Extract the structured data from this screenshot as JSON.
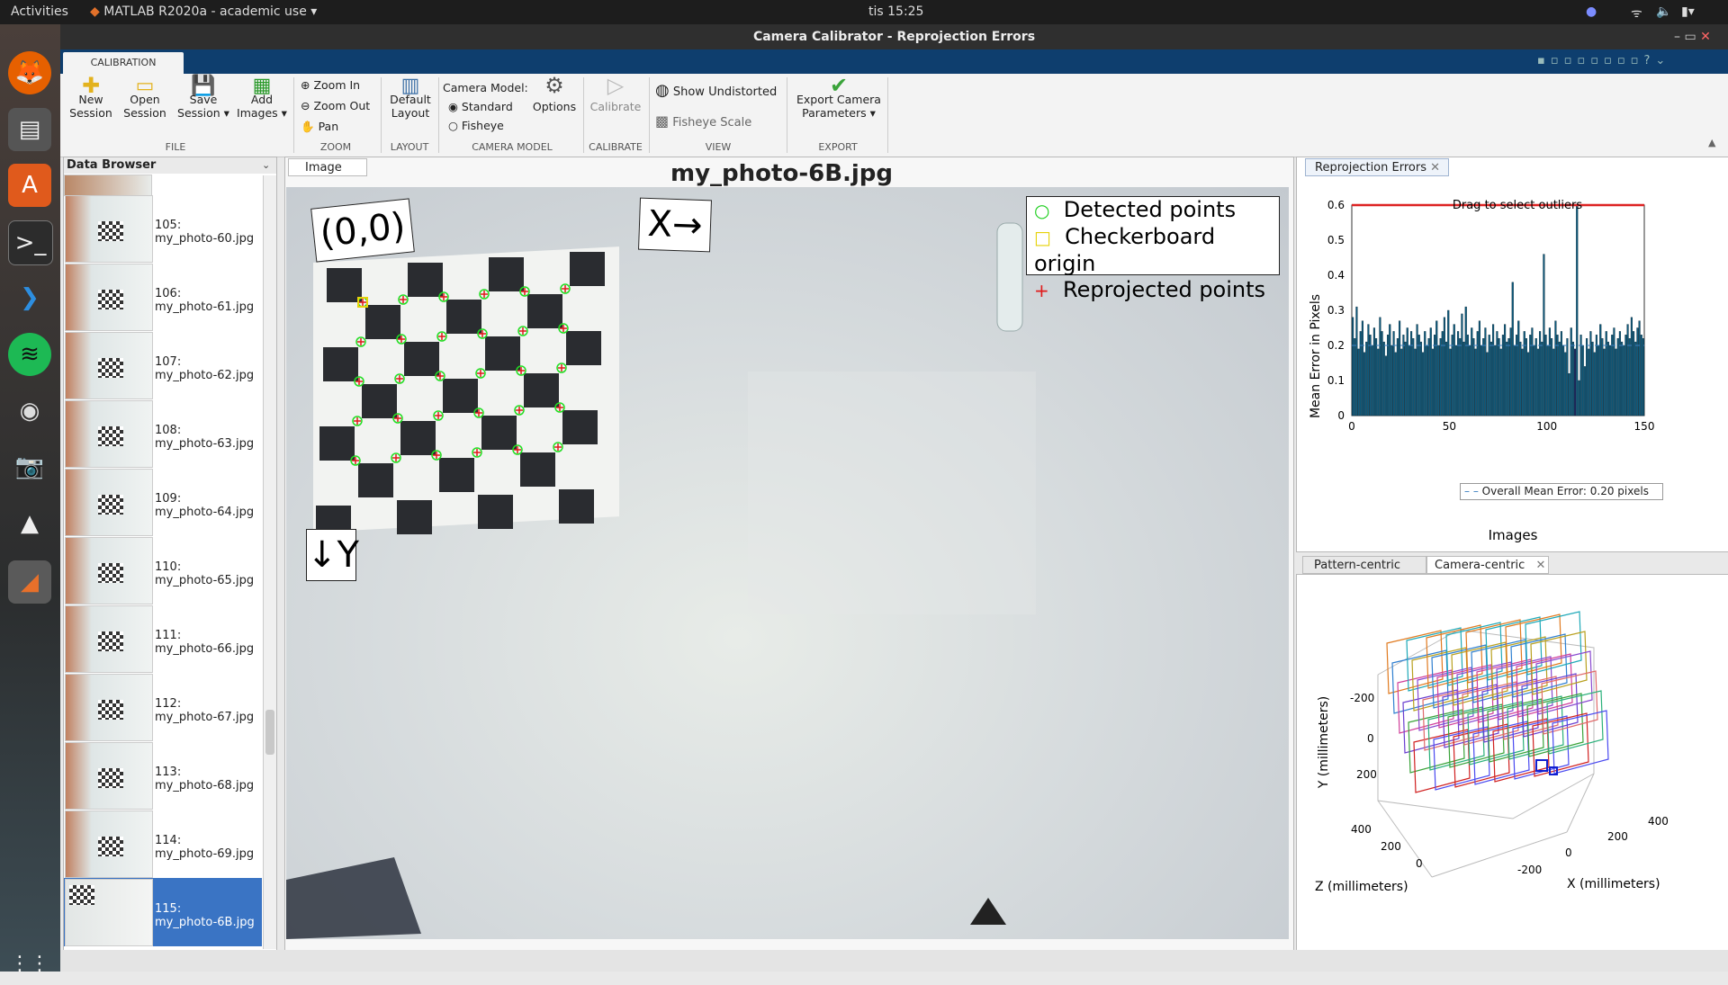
{
  "system": {
    "activities": "Activities",
    "app_name": "MATLAB R2020a - academic use",
    "clock": "tis 15:25"
  },
  "window": {
    "title": "Camera Calibrator - Reprojection Errors"
  },
  "toolstrip": {
    "tab": "CALIBRATION",
    "new_session": "New\nSession",
    "open_session": "Open\nSession",
    "save_session": "Save\nSession ▾",
    "add_images": "Add\nImages ▾",
    "group_file": "FILE",
    "zoom_in": "Zoom In",
    "zoom_out": "Zoom Out",
    "pan": "Pan",
    "group_zoom": "ZOOM",
    "default_layout": "Default\nLayout",
    "group_layout": "LAYOUT",
    "camera_model_label": "Camera Model:",
    "standard": "Standard",
    "fisheye": "Fisheye",
    "options": "Options",
    "group_camera_model": "CAMERA MODEL",
    "calibrate": "Calibrate",
    "group_calibrate": "CALIBRATE",
    "show_undistorted": "Show Undistorted",
    "fisheye_scale": "Fisheye Scale",
    "group_view": "VIEW",
    "export": "Export Camera\nParameters ▾",
    "group_export": "EXPORT"
  },
  "browser": {
    "title": "Data Browser",
    "items": [
      {
        "label": "105:\nmy_photo-60.jpg"
      },
      {
        "label": "106:\nmy_photo-61.jpg"
      },
      {
        "label": "107:\nmy_photo-62.jpg"
      },
      {
        "label": "108:\nmy_photo-63.jpg"
      },
      {
        "label": "109:\nmy_photo-64.jpg"
      },
      {
        "label": "110:\nmy_photo-65.jpg"
      },
      {
        "label": "111:\nmy_photo-66.jpg"
      },
      {
        "label": "112:\nmy_photo-67.jpg"
      },
      {
        "label": "113:\nmy_photo-68.jpg"
      },
      {
        "label": "114:\nmy_photo-69.jpg"
      },
      {
        "label": "115:\nmy_photo-6B.jpg"
      }
    ]
  },
  "image_panel": {
    "tab": "Image",
    "photo_title": "my_photo-6B.jpg",
    "origin_label": "(0,0)",
    "x_label": "X→",
    "y_label": "↓Y",
    "legend": {
      "detected": "Detected points",
      "origin": "Checkerboard origin",
      "reprojected": "Reprojected points"
    }
  },
  "reprojection": {
    "tab": "Reprojection Errors",
    "drag_hint": "Drag to select outliers",
    "mean_label": "Overall Mean Error: 0.20 pixels"
  },
  "extrinsics": {
    "tab_pattern": "Pattern-centric",
    "tab_camera": "Camera-centric",
    "y_axis": "Y (millimeters)",
    "z_axis": "Z (millimeters)",
    "x_axis": "X (millimeters)",
    "y_ticks": [
      "-200",
      "0",
      "200"
    ],
    "z_ticks": [
      "400",
      "200",
      "0"
    ],
    "x_ticks": [
      "400",
      "200",
      "0",
      "-200"
    ]
  },
  "chart_data": {
    "type": "bar",
    "title": "",
    "xlabel": "Images",
    "ylabel": "Mean Error in Pixels",
    "xlim": [
      0,
      150
    ],
    "ylim": [
      0,
      0.6
    ],
    "x_ticks": [
      0,
      50,
      100,
      150
    ],
    "y_ticks": [
      0,
      0.1,
      0.2,
      0.3,
      0.4,
      0.5,
      0.6
    ],
    "mean_error": 0.2,
    "outlier_threshold": 0.6,
    "selected_index": 115,
    "values": [
      0.28,
      0.22,
      0.31,
      0.19,
      0.24,
      0.27,
      0.18,
      0.21,
      0.26,
      0.23,
      0.2,
      0.25,
      0.22,
      0.19,
      0.28,
      0.24,
      0.21,
      0.17,
      0.23,
      0.26,
      0.2,
      0.24,
      0.18,
      0.22,
      0.27,
      0.19,
      0.23,
      0.21,
      0.25,
      0.2,
      0.24,
      0.22,
      0.19,
      0.26,
      0.23,
      0.21,
      0.18,
      0.24,
      0.2,
      0.22,
      0.25,
      0.19,
      0.23,
      0.27,
      0.2,
      0.22,
      0.24,
      0.28,
      0.21,
      0.3,
      0.19,
      0.23,
      0.26,
      0.2,
      0.24,
      0.22,
      0.29,
      0.21,
      0.31,
      0.23,
      0.2,
      0.25,
      0.22,
      0.19,
      0.24,
      0.27,
      0.2,
      0.22,
      0.25,
      0.18,
      0.23,
      0.21,
      0.26,
      0.2,
      0.24,
      0.22,
      0.19,
      0.23,
      0.26,
      0.21,
      0.22,
      0.25,
      0.38,
      0.2,
      0.23,
      0.27,
      0.21,
      0.19,
      0.24,
      0.22,
      0.18,
      0.23,
      0.25,
      0.2,
      0.22,
      0.19,
      0.24,
      0.21,
      0.46,
      0.23,
      0.2,
      0.25,
      0.22,
      0.19,
      0.27,
      0.23,
      0.21,
      0.24,
      0.2,
      0.18,
      0.22,
      0.12,
      0.25,
      0.21,
      0.19,
      0.6,
      0.1,
      0.23,
      0.2,
      0.14,
      0.22,
      0.19,
      0.24,
      0.21,
      0.18,
      0.23,
      0.2,
      0.26,
      0.22,
      0.19,
      0.24,
      0.21,
      0.2,
      0.23,
      0.25,
      0.19,
      0.22,
      0.24,
      0.21,
      0.2,
      0.23,
      0.26,
      0.22,
      0.28,
      0.24,
      0.21,
      0.25,
      0.27,
      0.23,
      0.22
    ]
  }
}
